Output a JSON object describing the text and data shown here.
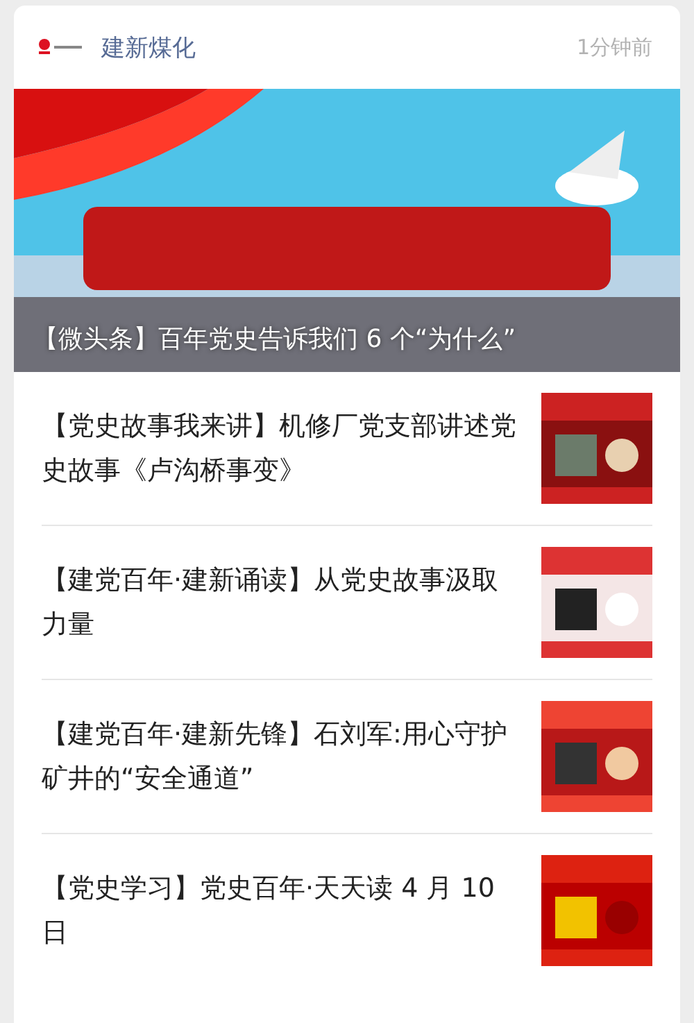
{
  "account": {
    "name": "建新煤化",
    "time": "1分钟前"
  },
  "headline": {
    "title": "【微头条】百年党史告诉我们 6 个“为什么”"
  },
  "articles": [
    {
      "title": "【党史故事我来讲】机修厂党支部讲述党史故事《卢沟桥事变》"
    },
    {
      "title": "【建党百年·建新诵读】从党史故事汲取力量"
    },
    {
      "title": "【建党百年·建新先锋】石刘军:用心守护矿井的“安全通道”"
    },
    {
      "title": "【党史学习】党史百年·天天读 4 月 10 日"
    }
  ]
}
